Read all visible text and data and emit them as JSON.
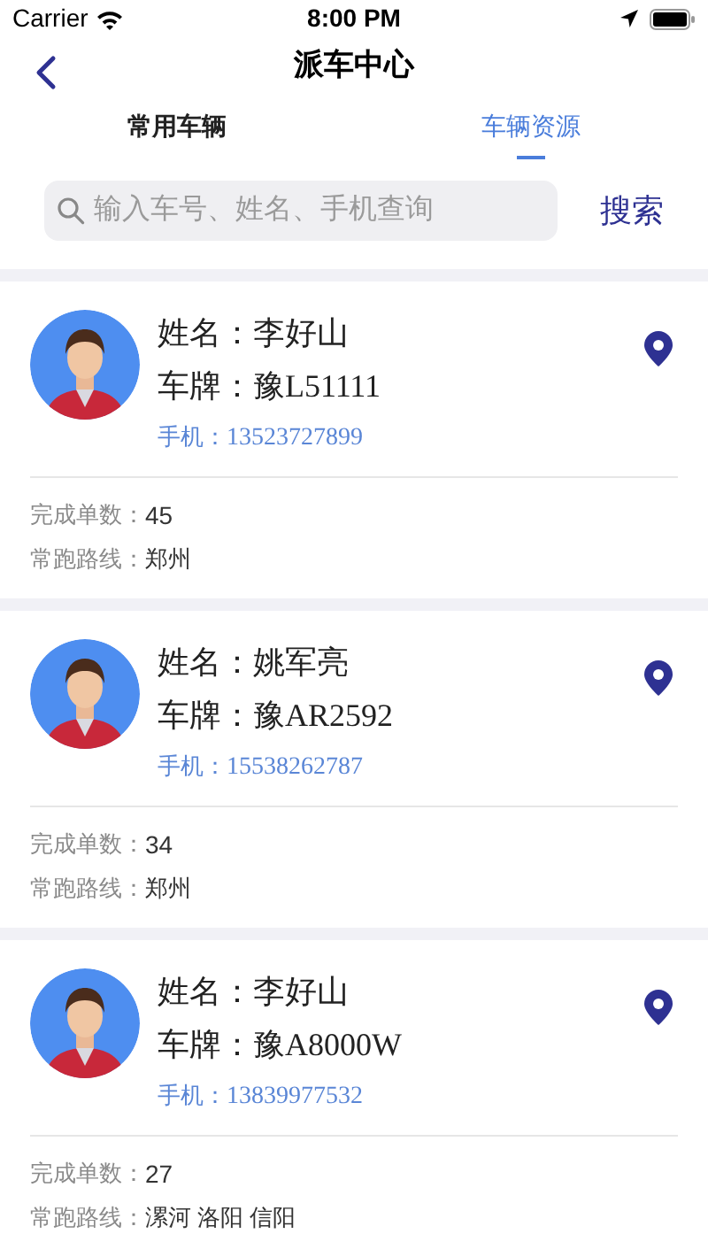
{
  "status_bar": {
    "carrier": "Carrier",
    "time": "8:00 PM"
  },
  "nav": {
    "title": "派车中心"
  },
  "tabs": [
    {
      "label": "常用车辆",
      "selected": false
    },
    {
      "label": "车辆资源",
      "selected": true
    }
  ],
  "search": {
    "placeholder": "输入车号、姓名、手机查询",
    "button": "搜索"
  },
  "drivers": [
    {
      "name_label": "姓名：",
      "name": "李好山",
      "plate_label": "车牌：",
      "plate": "豫L51111",
      "phone_label": "手机：",
      "phone": "13523727899",
      "orders_label": "完成单数：",
      "orders": "45",
      "route_label": "常跑路线：",
      "route": "郑州"
    },
    {
      "name_label": "姓名：",
      "name": "姚军亮",
      "plate_label": "车牌：",
      "plate": "豫AR2592",
      "phone_label": "手机：",
      "phone": "15538262787",
      "orders_label": "完成单数：",
      "orders": "34",
      "route_label": "常跑路线：",
      "route": "郑州"
    },
    {
      "name_label": "姓名：",
      "name": "李好山",
      "plate_label": "车牌：",
      "plate": "豫A8000W",
      "phone_label": "手机：",
      "phone": "13839977532",
      "orders_label": "完成单数：",
      "orders": "27",
      "route_label": "常跑路线：",
      "route": "漯河 洛阳 信阳"
    }
  ]
}
